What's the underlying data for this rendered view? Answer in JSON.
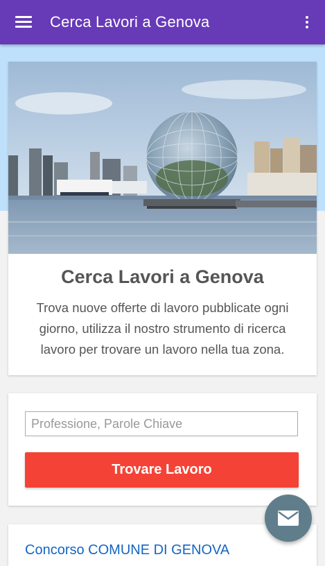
{
  "app_bar": {
    "title": "Cerca Lavori a Genova",
    "menu_icon": "hamburger-menu-icon",
    "overflow_icon": "more-vert-icon",
    "color": "#673ab7"
  },
  "hero": {
    "image": "genova-port-biosphere-photo",
    "title": "Cerca Lavori a Genova",
    "description": "Trova nuove offerte di lavoro pubblicate ogni giorno, utilizza il nostro strumento di ricerca lavoro per trovare un lavoro nella tua zona."
  },
  "search": {
    "placeholder": "Professione, Parole Chiave",
    "value": "",
    "button_label": "Trovare Lavoro",
    "button_color": "#f44336"
  },
  "listings": [
    {
      "title": "Concorso COMUNE DI GENOVA"
    }
  ],
  "fab": {
    "icon": "email-icon",
    "color": "#607d8b"
  }
}
